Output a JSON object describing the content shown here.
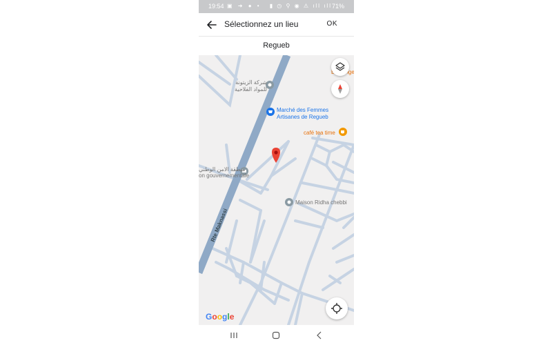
{
  "status_bar": {
    "time": "19:54",
    "left_icons": "▣ ➜ ● •",
    "right_icons": "▮ ◷ ⚲ ◉ ⚠ ıll ıll",
    "battery": "71%"
  },
  "app_bar": {
    "title": "Sélectionnez un lieu",
    "ok_label": "OK"
  },
  "location_name": "Regueb",
  "map": {
    "pois": {
      "zitouna": "شركة الزيتونة\nللمواد الفلاحية",
      "marche": "Marché des Femmes\nArtisanes de Regueb",
      "cafe": "café tea time",
      "securite": "منطقة الامن الوطني",
      "gouvernementale": "on gouvernementale",
      "maison": "Maison Ridha chebbi",
      "cutoff": "Boulanger..."
    },
    "road_label": "Rte Maknassi",
    "logo_text": "Google"
  },
  "colors": {
    "map_bg": "#f1f0f0",
    "road": "#c6d3e3",
    "main_road": "#8fa9c6",
    "pin": "#ea4335",
    "poi_blue": "#1a73e8",
    "poi_orange": "#e8710a"
  }
}
